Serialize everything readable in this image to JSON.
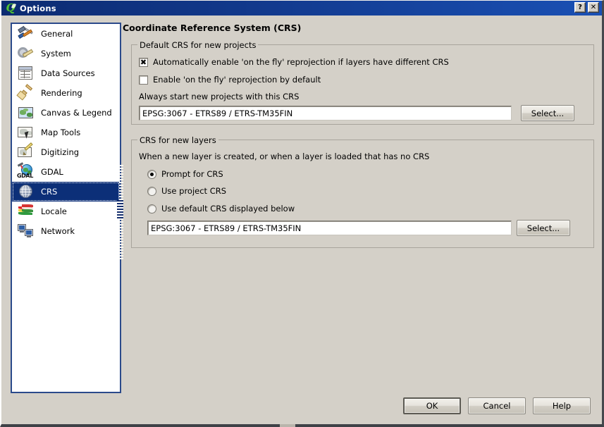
{
  "window": {
    "title": "Options",
    "logo_icon": "qgis-logo-icon",
    "help_button": "?",
    "close_button": "✕"
  },
  "sidebar": {
    "items": [
      {
        "label": "General",
        "icon": "hammer-screwdriver-icon",
        "selected": false
      },
      {
        "label": "System",
        "icon": "gear-wrench-icon",
        "selected": false
      },
      {
        "label": "Data Sources",
        "icon": "table-grid-icon",
        "selected": false
      },
      {
        "label": "Rendering",
        "icon": "paintbrush-icon",
        "selected": false
      },
      {
        "label": "Canvas & Legend",
        "icon": "map-frame-icon",
        "selected": false
      },
      {
        "label": "Map Tools",
        "icon": "map-cursor-icon",
        "selected": false
      },
      {
        "label": "Digitizing",
        "icon": "map-pencil-icon",
        "selected": false
      },
      {
        "label": "GDAL",
        "icon": "gdal-globe-icon",
        "selected": false
      },
      {
        "label": "CRS",
        "icon": "crs-globe-icon",
        "selected": true
      },
      {
        "label": "Locale",
        "icon": "flags-icon",
        "selected": false
      },
      {
        "label": "Network",
        "icon": "network-monitors-icon",
        "selected": false
      }
    ]
  },
  "content": {
    "page_title": "Coordinate Reference System (CRS)",
    "default_crs_group": {
      "legend": "Default CRS for new projects",
      "checkbox_auto_reproject": {
        "label": "Automatically enable 'on the fly' reprojection if layers have different CRS",
        "checked": true
      },
      "checkbox_enable_default": {
        "label": "Enable 'on the fly' reprojection by default",
        "checked": false
      },
      "field_label": "Always start new projects with this CRS",
      "crs_value": "EPSG:3067 - ETRS89 / ETRS-TM35FIN",
      "select_button": "Select..."
    },
    "new_layers_group": {
      "legend": "CRS for new layers",
      "description": "When a new layer is created, or when a layer is loaded that has no CRS",
      "radios": [
        {
          "label": "Prompt for CRS",
          "checked": true
        },
        {
          "label": "Use project CRS",
          "checked": false
        },
        {
          "label": "Use default CRS displayed below",
          "checked": false
        }
      ],
      "crs_value": "EPSG:3067 - ETRS89 / ETRS-TM35FIN",
      "select_button": "Select..."
    }
  },
  "footer": {
    "ok": "OK",
    "cancel": "Cancel",
    "help": "Help"
  },
  "colors": {
    "titlebar_start": "#0c2b72",
    "titlebar_end": "#1a50b4",
    "dialog_bg": "#d4d0c8",
    "selection_blue": "#0c2f78",
    "list_border": "#2b4a8b",
    "group_border": "#a8a49c"
  }
}
